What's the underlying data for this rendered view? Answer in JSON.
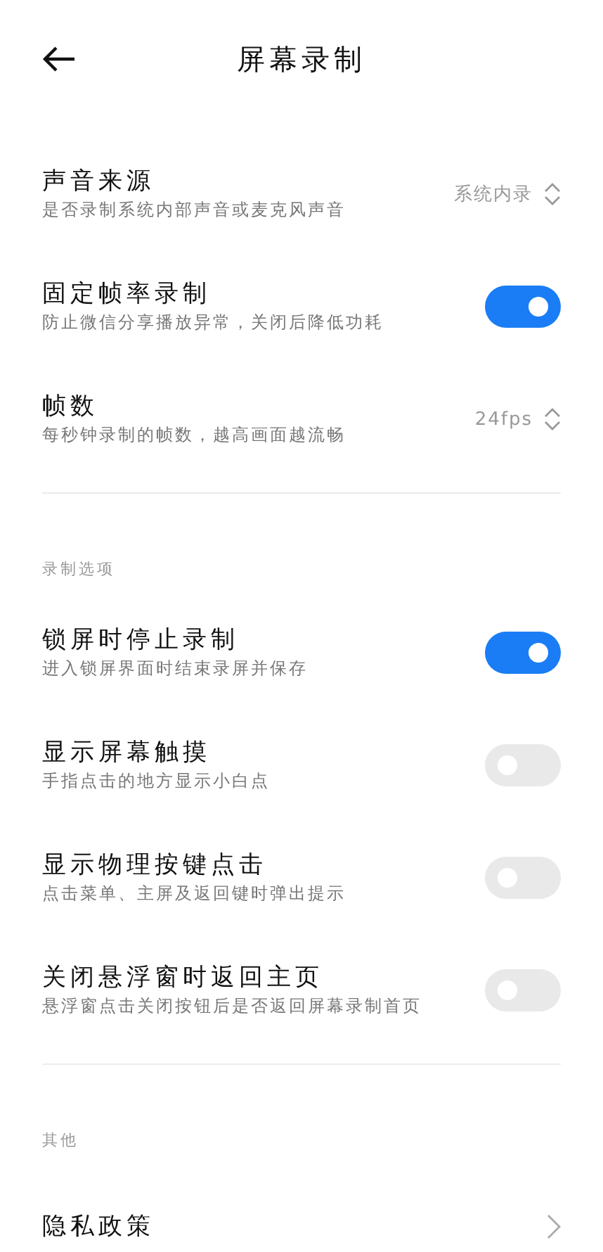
{
  "header": {
    "title": "屏幕录制"
  },
  "sections": [
    {
      "items": [
        {
          "kind": "select",
          "title": "声音来源",
          "subtitle": "是否录制系统内部声音或麦克风声音",
          "value": "系统内录"
        },
        {
          "kind": "toggle",
          "title": "固定帧率录制",
          "subtitle": "防止微信分享播放异常，关闭后降低功耗",
          "on": true
        },
        {
          "kind": "select",
          "title": "帧数",
          "subtitle": "每秒钟录制的帧数，越高画面越流畅",
          "value": "24fps"
        }
      ]
    },
    {
      "label": "录制选项",
      "items": [
        {
          "kind": "toggle",
          "title": "锁屏时停止录制",
          "subtitle": "进入锁屏界面时结束录屏并保存",
          "on": true
        },
        {
          "kind": "toggle",
          "title": "显示屏幕触摸",
          "subtitle": "手指点击的地方显示小白点",
          "on": false
        },
        {
          "kind": "toggle",
          "title": "显示物理按键点击",
          "subtitle": "点击菜单、主屏及返回键时弹出提示",
          "on": false
        },
        {
          "kind": "toggle",
          "title": "关闭悬浮窗时返回主页",
          "subtitle": "悬浮窗点击关闭按钮后是否返回屏幕录制首页",
          "on": false
        }
      ]
    },
    {
      "label": "其他",
      "items": [
        {
          "kind": "link",
          "title": "隐私政策"
        }
      ]
    }
  ]
}
